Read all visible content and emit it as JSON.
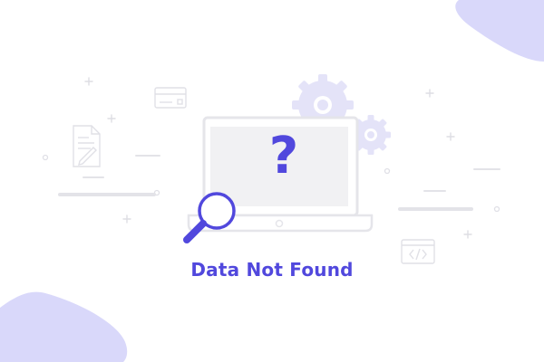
{
  "message": {
    "title": "Data Not Found",
    "symbol": "?"
  },
  "icons": [
    "blob-corner-shape",
    "credit-card-icon",
    "document-pencil-icon",
    "gear-icon",
    "laptop-icon",
    "magnifier-icon",
    "code-window-icon"
  ],
  "colors": {
    "accent": "#5148dd",
    "accent_soft": "#dcdbfb",
    "blob": "#d9d8fa",
    "line": "#e3e3e8",
    "screen": "#f1f1f3"
  }
}
